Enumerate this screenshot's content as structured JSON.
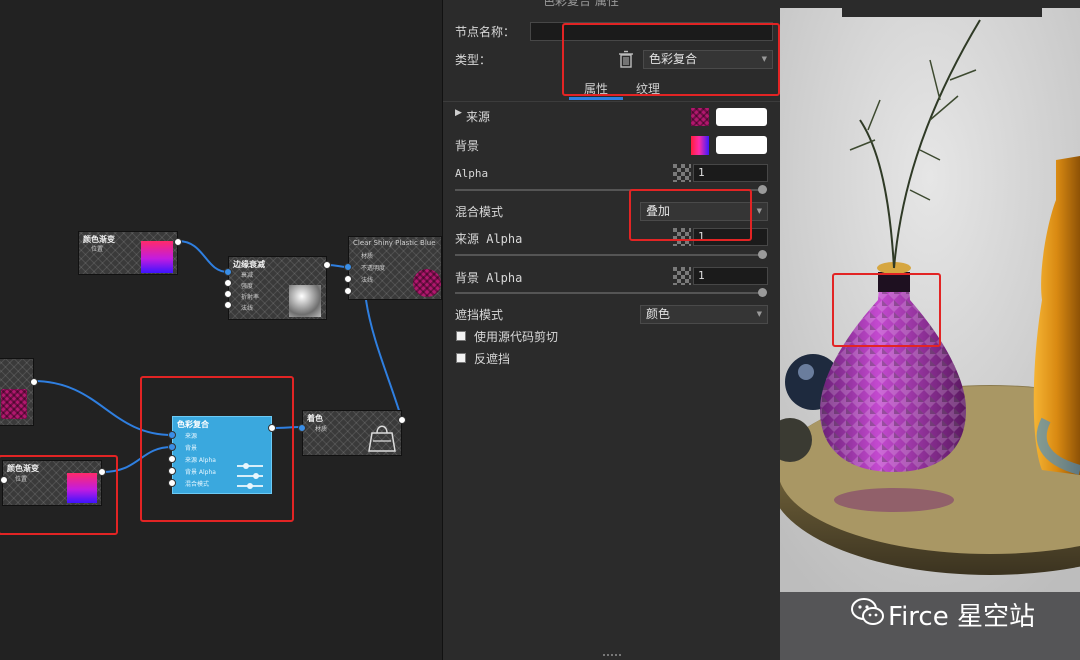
{
  "graph": {
    "nodes": {
      "gradient_top": {
        "title": "颜色渐变",
        "rows": [
          "位置"
        ]
      },
      "fresnel": {
        "title": "边缘衰减",
        "rows": [
          "衰减",
          "强度",
          "折射率",
          "法线"
        ]
      },
      "material": {
        "title": "Clear Shiny Plastic Blue",
        "rows": [
          "材质",
          "不透明度",
          "法线"
        ]
      },
      "blend": {
        "title": "色彩复合",
        "rows": [
          "来源",
          "背景",
          "来源 Alpha",
          "背景 Alpha",
          "混合模式"
        ]
      },
      "output": {
        "title": "着色",
        "rows": [
          "材质"
        ]
      },
      "gradient_bottom": {
        "title": "颜色渐变",
        "rows": [
          "位置"
        ]
      }
    }
  },
  "panel": {
    "window_title": "色彩复合 属性",
    "node_name_label": "节点名称：",
    "node_name_value": "",
    "type_label": "类型：",
    "type_value": "色彩复合",
    "tabs": [
      "属性",
      "纹理"
    ],
    "active_tab": "属性",
    "source_label": "来源",
    "background_label": "背景",
    "alpha_label": "Alpha",
    "alpha_value": "1",
    "blend_mode_label": "混合模式",
    "blend_mode_value": "叠加",
    "source_alpha_label": "来源 Alpha",
    "source_alpha_value": "1",
    "bg_alpha_label": "背景 Alpha",
    "bg_alpha_value": "1",
    "mask_mode_label": "遮挡模式",
    "mask_mode_value": "颜色",
    "use_source_clip_label": "使用源代码剪切",
    "invert_mask_label": "反遮挡",
    "colors": {
      "gradient_top": "#ff2a6a",
      "gradient_mid": "#c21ce0",
      "gradient_bottom": "#3d14ff",
      "highlight": "#e22424",
      "accent": "#3aa8de"
    }
  },
  "watermark": "Firce 星空站"
}
